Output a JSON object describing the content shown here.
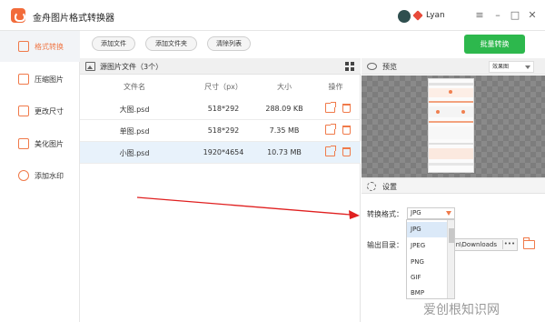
{
  "app": {
    "title": "金舟图片格式转换器"
  },
  "user": {
    "name": "Lyan"
  },
  "window_controls": {
    "menu": "≡",
    "minimize": "–",
    "maximize": "□",
    "close": "✕"
  },
  "sidebar": {
    "items": [
      {
        "label": "格式转换",
        "icon": "convert-icon"
      },
      {
        "label": "压缩图片",
        "icon": "compress-icon"
      },
      {
        "label": "更改尺寸",
        "icon": "resize-icon"
      },
      {
        "label": "美化图片",
        "icon": "beautify-icon"
      },
      {
        "label": "添加水印",
        "icon": "watermark-icon"
      }
    ]
  },
  "toolbar": {
    "add_file": "添加文件",
    "add_folder": "添加文件夹",
    "clear_list": "清除列表",
    "batch_convert": "批量转换"
  },
  "file_list": {
    "title": "源图片文件（3个）",
    "columns": [
      "文件名",
      "尺寸（px）",
      "大小",
      "操作"
    ],
    "rows": [
      {
        "name": "大图.psd",
        "size_px": "518*292",
        "size": "288.09 KB"
      },
      {
        "name": "单图.psd",
        "size_px": "518*292",
        "size": "7.35 MB"
      },
      {
        "name": "小图.psd",
        "size_px": "1920*4654",
        "size": "10.73 MB"
      }
    ]
  },
  "preview": {
    "title": "预览",
    "effect_select": "效果图"
  },
  "settings": {
    "title": "设置",
    "format_label": "转换格式：",
    "format_value": "JPG",
    "output_label": "输出目录：",
    "output_value": "n\\Downloads",
    "more_label": "•••",
    "format_options": [
      "JPG",
      "JPEG",
      "PNG",
      "GIF",
      "BMP"
    ]
  },
  "watermark_text": "爱创根知识网",
  "colors": {
    "accent": "#f07a4a",
    "primary_button": "#2db84d",
    "selected_row": "#e8f2fb",
    "annotation_arrow": "#e02020"
  }
}
